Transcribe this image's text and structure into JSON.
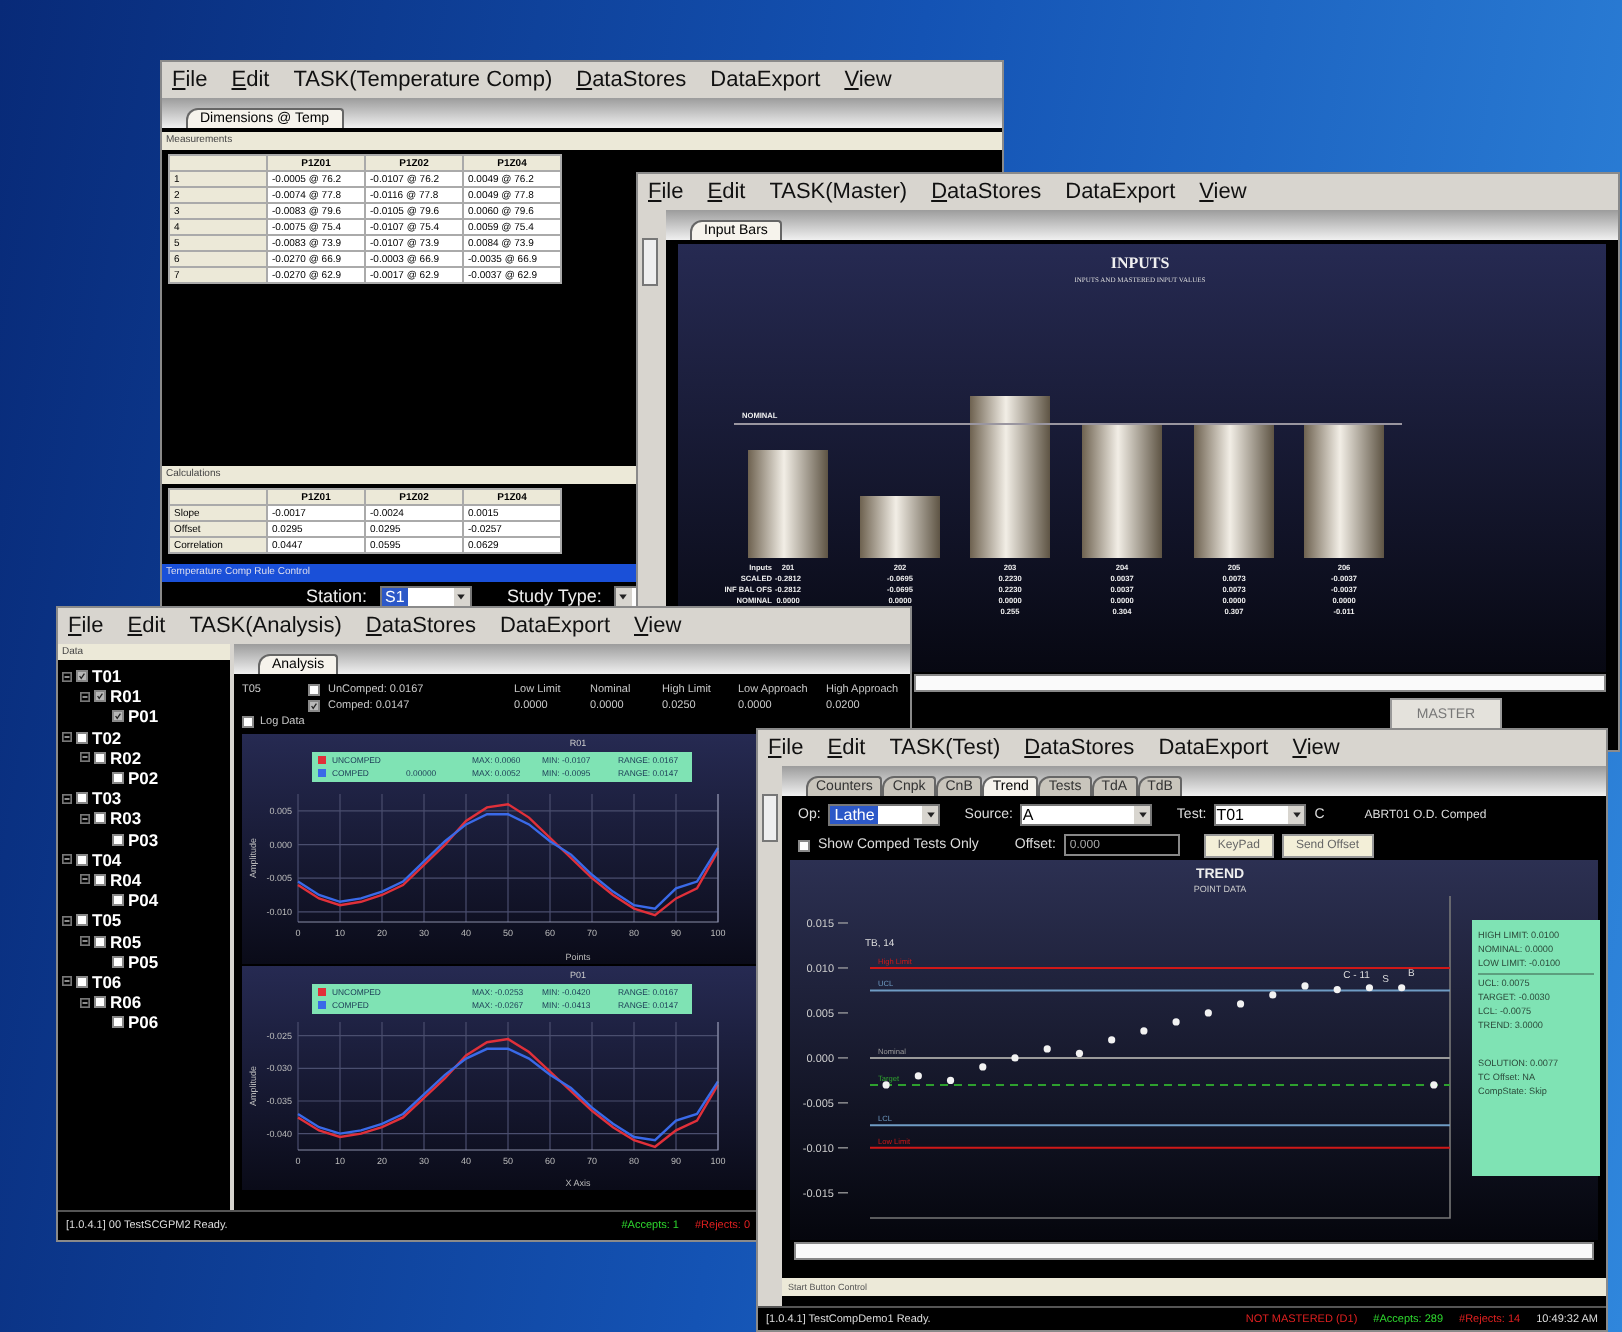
{
  "temperature_comp_window": {
    "menu": [
      {
        "label": "File",
        "underlined": true
      },
      {
        "label": "Edit",
        "underlined": true
      },
      {
        "label": "TASK(Temperature Comp)",
        "underlined": false
      },
      {
        "label": "DataStores",
        "underlined": true
      },
      {
        "label": "DataExport",
        "underlined": false
      },
      {
        "label": "View",
        "underlined": true
      }
    ],
    "tabs": [
      {
        "label": "Dimensions @ Temp",
        "selected": true
      }
    ],
    "measurements": {
      "title": "Measurements",
      "columns": [
        "P1Z01",
        "P1Z02",
        "P1Z04"
      ],
      "rows": [
        {
          "label": "1",
          "cells": [
            "-0.0005 @ 76.2",
            "-0.0107 @ 76.2",
            "0.0049 @ 76.2"
          ]
        },
        {
          "label": "2",
          "cells": [
            "-0.0074 @ 77.8",
            "-0.0116 @ 77.8",
            "0.0049 @ 77.8"
          ]
        },
        {
          "label": "3",
          "cells": [
            "-0.0083 @ 79.6",
            "-0.0105 @ 79.6",
            "0.0060 @ 79.6"
          ]
        },
        {
          "label": "4",
          "cells": [
            "-0.0075 @ 75.4",
            "-0.0107 @ 75.4",
            "0.0059 @ 75.4"
          ]
        },
        {
          "label": "5",
          "cells": [
            "-0.0083 @ 73.9",
            "-0.0107 @ 73.9",
            "0.0084 @ 73.9"
          ]
        },
        {
          "label": "6",
          "cells": [
            "-0.0270 @ 66.9",
            "-0.0003 @ 66.9",
            "-0.0035 @ 66.9"
          ]
        },
        {
          "label": "7",
          "cells": [
            "-0.0270 @ 62.9",
            "-0.0017 @ 62.9",
            "-0.0037 @ 62.9"
          ]
        }
      ]
    },
    "calculations": {
      "title": "Calculations",
      "columns": [
        "P1Z01",
        "P1Z02",
        "P1Z04"
      ],
      "rows": [
        {
          "label": "Slope",
          "cells": [
            "-0.0017",
            "-0.0024",
            "0.0015"
          ]
        },
        {
          "label": "Offset",
          "cells": [
            "0.0295",
            "0.0295",
            "-0.0257"
          ]
        },
        {
          "label": "Correlation",
          "cells": [
            "0.0447",
            "0.0595",
            "0.0629"
          ]
        }
      ]
    },
    "rule_bar": "Temperature Comp Rule Control",
    "station": {
      "label": "Station:",
      "value": "S1"
    },
    "study_type": {
      "label": "Study Type:"
    }
  },
  "master_window": {
    "menu": [
      {
        "label": "File",
        "underlined": true
      },
      {
        "label": "Edit",
        "underlined": true
      },
      {
        "label": "TASK(Master)",
        "underlined": false
      },
      {
        "label": "DataStores",
        "underlined": true
      },
      {
        "label": "DataExport",
        "underlined": false
      },
      {
        "label": "View",
        "underlined": true
      }
    ],
    "tabs": [
      {
        "label": "Input Bars",
        "selected": true
      }
    ],
    "chart": {
      "title": "INPUTS",
      "subtitle": "INPUTS AND MASTERED INPUT VALUES",
      "nominal_label": "NOMINAL",
      "rows": [
        {
          "label": "Inputs",
          "cells": [
            "201",
            "202",
            "203",
            "204",
            "205",
            "206"
          ]
        },
        {
          "label": "SCALED",
          "cells": [
            "-0.2812",
            "-0.0695",
            "0.2230",
            "0.0037",
            "0.0073",
            "-0.0037"
          ]
        },
        {
          "label": "INF BAL OFS",
          "cells": [
            "-0.2812",
            "-0.0695",
            "0.2230",
            "0.0037",
            "0.0073",
            "-0.0037"
          ]
        },
        {
          "label": "NOMINAL",
          "cells": [
            "0.0000",
            "0.0000",
            "0.0000",
            "0.0000",
            "0.0000",
            "0.0000"
          ]
        },
        {
          "cells": [
            null,
            null,
            "0.255",
            "0.304",
            "0.307",
            "-0.011"
          ]
        }
      ]
    },
    "button": "MASTER"
  },
  "analysis_window": {
    "menu": [
      {
        "label": "File",
        "underlined": true
      },
      {
        "label": "Edit",
        "underlined": true
      },
      {
        "label": "TASK(Analysis)",
        "underlined": false
      },
      {
        "label": "DataStores",
        "underlined": true
      },
      {
        "label": "DataExport",
        "underlined": false
      },
      {
        "label": "View",
        "underlined": true
      }
    ],
    "tree": {
      "title": "Data",
      "items": [
        {
          "label": "T01",
          "checked": true,
          "expanded": true,
          "children": [
            {
              "label": "R01",
              "checked": true,
              "expanded": true,
              "children": [
                {
                  "label": "P01",
                  "checked": true
                }
              ]
            }
          ]
        },
        {
          "label": "T02",
          "checked": false,
          "expanded": true,
          "children": [
            {
              "label": "R02",
              "checked": false,
              "expanded": true,
              "children": [
                {
                  "label": "P02",
                  "checked": false
                }
              ]
            }
          ]
        },
        {
          "label": "T03",
          "checked": false,
          "expanded": true,
          "children": [
            {
              "label": "R03",
              "checked": false,
              "expanded": true,
              "children": [
                {
                  "label": "P03",
                  "checked": false
                }
              ]
            }
          ]
        },
        {
          "label": "T04",
          "checked": false,
          "expanded": true,
          "children": [
            {
              "label": "R04",
              "checked": false,
              "expanded": true,
              "children": [
                {
                  "label": "P04",
                  "checked": false
                }
              ]
            }
          ]
        },
        {
          "label": "T05",
          "checked": false,
          "expanded": true,
          "children": [
            {
              "label": "R05",
              "checked": false,
              "expanded": true,
              "children": [
                {
                  "label": "P05",
                  "checked": false
                }
              ]
            }
          ]
        },
        {
          "label": "T06",
          "checked": false,
          "expanded": true,
          "children": [
            {
              "label": "R06",
              "checked": false,
              "expanded": true,
              "children": [
                {
                  "label": "P06",
                  "checked": false
                }
              ]
            }
          ]
        }
      ]
    },
    "tabs": [
      {
        "label": "Analysis",
        "selected": true
      }
    ],
    "header": {
      "test": "T05",
      "uncomped": {
        "label": "UnComped: 0.0167",
        "checked": false
      },
      "comped": {
        "label": "Comped: 0.0147",
        "checked": true
      },
      "limits": [
        {
          "label": "Low Limit",
          "value": "0.0000"
        },
        {
          "label": "Nominal",
          "value": "0.0000"
        },
        {
          "label": "High Limit",
          "value": "0.0250"
        },
        {
          "label": "Low Approach",
          "value": "0.0000"
        },
        {
          "label": "High Approach",
          "value": "0.0200"
        }
      ],
      "log_data": {
        "label": "Log Data",
        "checked": false
      }
    },
    "charts": [
      {
        "legend_values": [
          {
            "max": "MAX: 0.0060",
            "min": "MIN: -0.0107",
            "range": "RANGE: 0.0167"
          },
          {
            "value": "0.00000",
            "max": "MAX: 0.0052",
            "min": "MIN: -0.0095",
            "range": "RANGE: 0.0147"
          }
        ],
        "chart_data": {
          "type": "line",
          "title": "R01",
          "xlabel": "Points",
          "ylabel": "Amplitude",
          "x": [
            0,
            5,
            10,
            15,
            20,
            25,
            30,
            35,
            40,
            45,
            50,
            55,
            60,
            65,
            70,
            75,
            80,
            85,
            90,
            95,
            100
          ],
          "series": [
            {
              "name": "UNCOMPED",
              "color": "#e0303a",
              "values": [
                -0.006,
                -0.008,
                -0.009,
                -0.0085,
                -0.0075,
                -0.006,
                -0.003,
                0.0,
                0.0035,
                0.0055,
                0.006,
                0.004,
                0.001,
                -0.002,
                -0.005,
                -0.0075,
                -0.0095,
                -0.0105,
                -0.008,
                -0.0065,
                -0.001
              ]
            },
            {
              "name": "COMPED",
              "color": "#3a6ae8",
              "values": [
                -0.0055,
                -0.0075,
                -0.0085,
                -0.008,
                -0.007,
                -0.0055,
                -0.0025,
                0.0005,
                0.003,
                0.0045,
                0.0045,
                0.003,
                0.0005,
                -0.0015,
                -0.0045,
                -0.007,
                -0.009,
                -0.0095,
                -0.0065,
                -0.0055,
                -0.0005
              ]
            }
          ],
          "grid": true,
          "legend": "top",
          "xlim": [
            0,
            100
          ],
          "ylim": [
            -0.0115,
            0.0075
          ],
          "xticks": [
            0,
            10,
            20,
            30,
            40,
            50,
            60,
            70,
            80,
            90,
            100
          ],
          "yticks": [
            {
              "value": 0.005,
              "label": "0.005"
            },
            {
              "value": 0,
              "label": "0.000"
            },
            {
              "value": -0.005,
              "label": "-0.005"
            },
            {
              "value": -0.01,
              "label": "-0.010"
            }
          ]
        }
      },
      {
        "legend_values": [
          {
            "max": "MAX: -0.0253",
            "min": "MIN: -0.0420",
            "range": "RANGE: 0.0167"
          },
          {
            "max": "MAX: -0.0267",
            "min": "MIN: -0.0413",
            "range": "RANGE: 0.0147"
          }
        ],
        "chart_data": {
          "type": "line",
          "title": "P01",
          "xlabel": "X Axis",
          "ylabel": "Amplitude",
          "x": [
            0,
            5,
            10,
            15,
            20,
            25,
            30,
            35,
            40,
            45,
            50,
            55,
            60,
            65,
            70,
            75,
            80,
            85,
            90,
            95,
            100
          ],
          "series": [
            {
              "name": "UNCOMPED",
              "color": "#e0303a",
              "values": [
                -0.0375,
                -0.0395,
                -0.0405,
                -0.04,
                -0.039,
                -0.0375,
                -0.0345,
                -0.0315,
                -0.028,
                -0.026,
                -0.0255,
                -0.0275,
                -0.0305,
                -0.0335,
                -0.0365,
                -0.039,
                -0.041,
                -0.042,
                -0.0395,
                -0.038,
                -0.0325
              ]
            },
            {
              "name": "COMPED",
              "color": "#3a6ae8",
              "values": [
                -0.037,
                -0.039,
                -0.04,
                -0.0395,
                -0.0385,
                -0.037,
                -0.034,
                -0.031,
                -0.0285,
                -0.027,
                -0.027,
                -0.0285,
                -0.031,
                -0.033,
                -0.036,
                -0.0385,
                -0.0405,
                -0.041,
                -0.038,
                -0.037,
                -0.032
              ]
            }
          ],
          "grid": true,
          "legend": "top",
          "xlim": [
            0,
            100
          ],
          "ylim": [
            -0.0425,
            -0.0229
          ],
          "xticks": [
            0,
            10,
            20,
            30,
            40,
            50,
            60,
            70,
            80,
            90,
            100
          ],
          "yticks": [
            {
              "value": -0.025,
              "label": "-0.025"
            },
            {
              "value": -0.03,
              "label": "-0.030"
            },
            {
              "value": -0.035,
              "label": "-0.035"
            },
            {
              "value": -0.04,
              "label": "-0.040"
            }
          ]
        }
      }
    ],
    "status": {
      "text": "[1.0.4.1] 00 TestSCGPM2  Ready.",
      "accepts": "#Accepts: 1",
      "rejects": "#Rejects: 0"
    }
  },
  "test_window": {
    "menu": [
      {
        "label": "File",
        "underlined": true
      },
      {
        "label": "Edit",
        "underlined": true
      },
      {
        "label": "TASK(Test)",
        "underlined": false
      },
      {
        "label": "DataStores",
        "underlined": true
      },
      {
        "label": "DataExport",
        "underlined": false
      },
      {
        "label": "View",
        "underlined": true
      }
    ],
    "tabs": [
      {
        "label": "Counters",
        "selected": false
      },
      {
        "label": "Cnpk",
        "selected": false
      },
      {
        "label": "CnB",
        "selected": false
      },
      {
        "label": "Trend",
        "selected": true
      },
      {
        "label": "Tests",
        "selected": false
      },
      {
        "label": "TdA",
        "selected": false
      },
      {
        "label": "TdB",
        "selected": false
      }
    ],
    "op": {
      "label": "Op:",
      "value": "Lathe"
    },
    "source": {
      "label": "Source:",
      "value": "A"
    },
    "test": {
      "label": "Test:",
      "value": "T01"
    },
    "state_code": "C",
    "test_name": "ABRT01 O.D. Comped",
    "show_comped": {
      "label": "Show Comped Tests Only",
      "checked": false
    },
    "offset": {
      "label": "Offset:",
      "value": "0.000"
    },
    "buttons": [
      "KeyPad",
      "Send Offset"
    ],
    "trend": {
      "subtitle": "POINT DATA",
      "point_labels": [
        "TB, 14",
        "C - 11",
        "S",
        "B"
      ],
      "info": [
        [
          "HIGH LIMIT: 0.0100",
          "NOMINAL: 0.0000",
          "LOW LIMIT: -0.0100"
        ],
        [
          "UCL: 0.0075",
          "TARGET: -0.0030",
          "LCL: -0.0075",
          "TREND: 3.0000"
        ],
        [
          "SOLUTION: 0.0077",
          "TC Offset: NA",
          "CompState: Skip"
        ]
      ],
      "chart_data": {
        "type": "scatter",
        "title": "TREND",
        "categories": [
          null,
          null,
          null,
          null,
          null,
          null,
          null,
          null,
          null,
          null,
          null,
          null,
          null,
          null,
          null,
          null,
          null,
          null
        ],
        "values": [
          -0.003,
          -0.002,
          -0.0025,
          -0.001,
          0.0,
          0.001,
          0.0005,
          0.002,
          0.003,
          0.004,
          0.005,
          0.006,
          0.007,
          0.008,
          0.0076,
          0.0078,
          0.0078,
          -0.003
        ],
        "ylim": [
          -0.0178,
          0.018
        ],
        "ref_lines": [
          {
            "axis": "y",
            "value": 0.01,
            "label": "High Limit",
            "color": "#d01818"
          },
          {
            "axis": "y",
            "value": 0.0075,
            "label": "UCL",
            "color": "#6f9cc4"
          },
          {
            "axis": "y",
            "value": 0,
            "label": "Nominal",
            "color": "#9a9a9a"
          },
          {
            "axis": "y",
            "value": -0.003,
            "label": "Target",
            "color": "#2ea02e"
          },
          {
            "axis": "y",
            "value": -0.0075,
            "label": "LCL",
            "color": "#6f9cc4"
          },
          {
            "axis": "y",
            "value": -0.01,
            "label": "Low Limit",
            "color": "#d01818"
          }
        ],
        "yticks": [
          {
            "value": 0.015,
            "label": "0.015"
          },
          {
            "value": 0.01,
            "label": "0.010"
          },
          {
            "value": 0.005,
            "label": "0.005"
          },
          {
            "value": 0,
            "label": "0.000"
          },
          {
            "value": -0.005,
            "label": "-0.005"
          },
          {
            "value": -0.01,
            "label": "-0.010"
          },
          {
            "value": -0.015,
            "label": "-0.015"
          }
        ]
      }
    },
    "control_bar": "Start Button Control",
    "status": {
      "text": "[1.0.4.1] TestCompDemo1  Ready.",
      "mastered": "NOT MASTERED (D1)",
      "accepts": "#Accepts: 289",
      "rejects": "#Rejects: 14",
      "time": "10:49:32 AM"
    }
  }
}
